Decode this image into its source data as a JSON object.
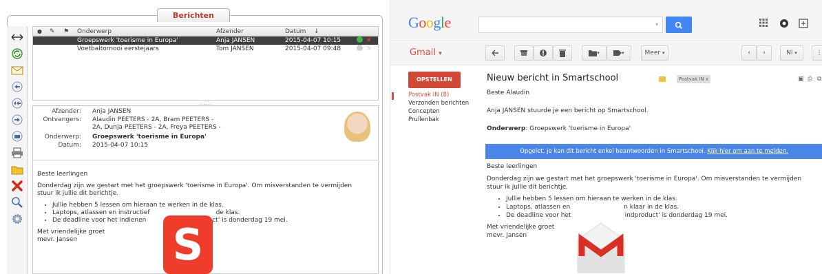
{
  "smartschool": {
    "window_title": "Berichten",
    "columns": [
      "Onderwerp",
      "Afzender",
      "Datum"
    ],
    "sort_indicator": "↓",
    "messages": [
      {
        "subject": "Groepswerk 'toerisme in Europa'",
        "sender": "Anja JANSEN",
        "date": "2015-04-07 10:15"
      },
      {
        "subject": "Voetbaltornooi eerstejaars",
        "sender": "Tom JANSEN",
        "date": "2015-04-07 09:48"
      }
    ],
    "header_labels": {
      "from": "Afzender:",
      "to": "Ontvangers:",
      "subject": "Onderwerp:",
      "date": "Datum:"
    },
    "header_values": {
      "from": "Anja JANSEN",
      "to_line1": "Alaudin PEETERS - 2A, Bram PEETERS -",
      "to_line2": "2A, Dunja PEETERS - 2A, Freya PEETERS -",
      "subject": "Groepswerk 'toerisme in Europa'",
      "date": "2015-04-07 10:15"
    },
    "body": {
      "greeting": "Beste leerlingen",
      "intro_line1": "Donderdag zijn we gestart met het groepswerk 'toerisme in Europa'. Om misverstanden te vermijden",
      "intro_line2": "stuur ik jullie dit berichtje.",
      "bullets": [
        "Jullie hebben 5 lessen om hieraan te werken in de klas.",
        "Laptops, atlassen en instructief",
        "De deadline voor het indienen"
      ],
      "bullet_tails": [
        "",
        "de klas.",
        "ct' is donderdag 19 mei."
      ],
      "closing": "Met vriendelijke groet",
      "signature": "mevr. Jansen"
    },
    "logo_letter": "S",
    "logo_color": "#ee3d2b"
  },
  "gmail": {
    "google_logo": "Google",
    "app_label": "Gmail",
    "app_label_arrow": "▾",
    "more_label": "Meer",
    "dropdown_arrow": "▾",
    "lang_label": "Nl",
    "compose_label": "OPSTELLEN",
    "nav": [
      "Postvak IN (8)",
      "Verzonden berichten",
      "Concepten",
      "Prullenbak"
    ],
    "subject": "Nieuw bericht in Smartschool",
    "inbox_label": "Postvak IN",
    "label_close": "x",
    "greeting": "Beste Alaudin",
    "notify_line": "Anja JANSEN stuurde je een bericht op Smartschool.",
    "subject_prefix": "Onderwerp",
    "subject_value": ": Groepswerk 'toerisme in Europa'",
    "banner_text": "Opgelet, je kan dit bericht enkel beantwoorden in Smartschool.",
    "banner_link": "Klik hier om aan te melden.",
    "body": {
      "greeting": "Beste leerlingen",
      "intro_line1": "Donderdag zijn we gestart met het groepswerk 'toerisme in Europa'. Om misverstanden te vermijden",
      "intro_line2": "stuur ik jullie dit berichtje.",
      "bullets": [
        "Jullie hebben 5 lessen om hieraan te werken in de klas.",
        "Laptops, atlassen en",
        "De deadline voor het"
      ],
      "bullet_tails": [
        "",
        "n klaar in de klas.",
        "indproduct' is donderdag 19 mei."
      ],
      "closing": "Met vriendelijke groet",
      "signature": "mevr. Jansen"
    },
    "accent_red": "#dd4b39",
    "accent_blue": "#4285f4"
  }
}
